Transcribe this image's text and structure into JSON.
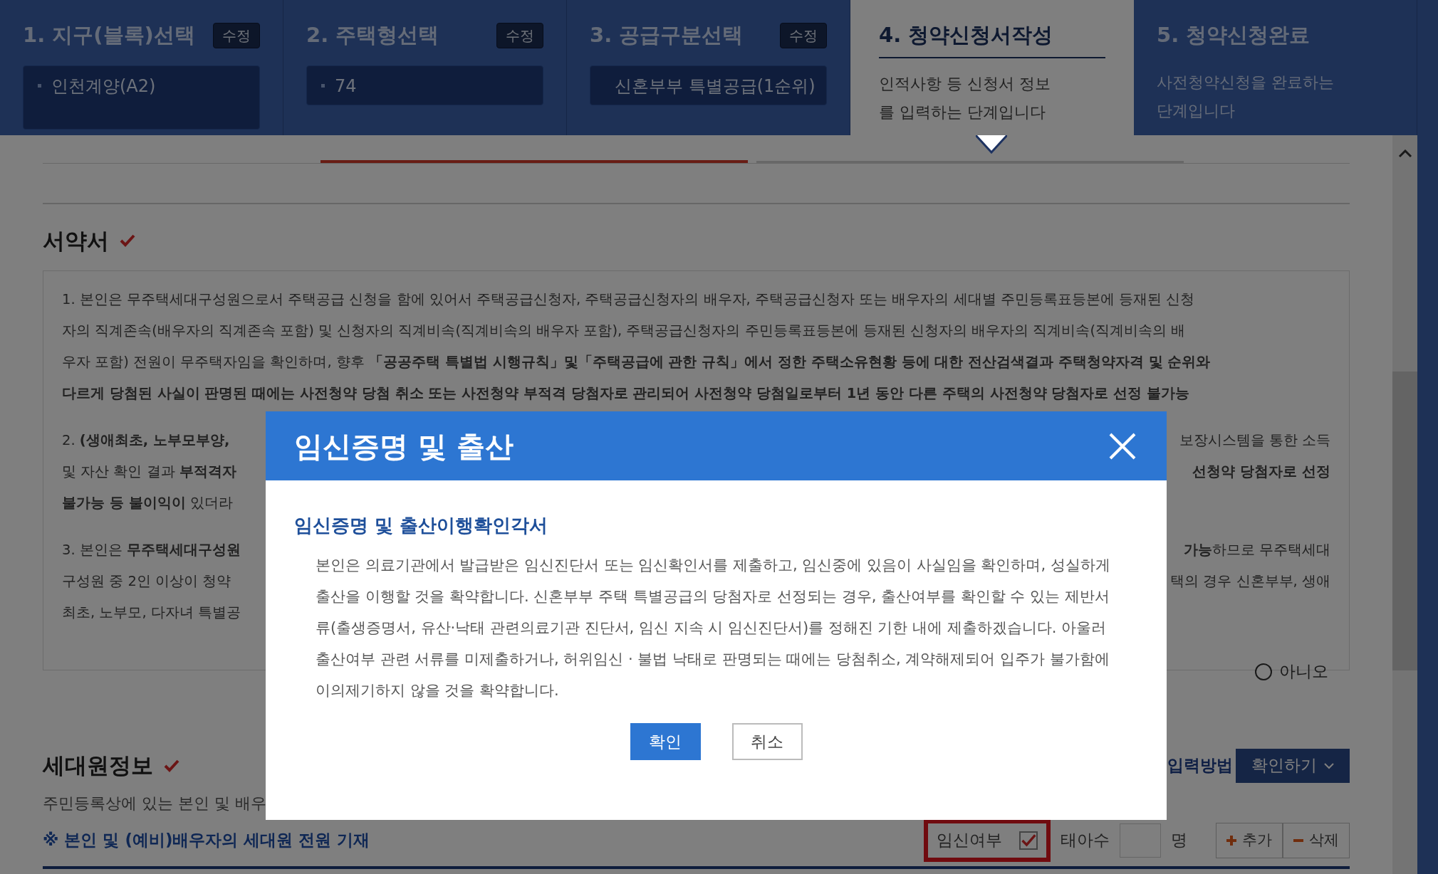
{
  "steps": [
    {
      "title": "1. 지구(블록)선택",
      "edit_button": "수정",
      "value": "인천계양(A2)",
      "selected": false
    },
    {
      "title": "2. 주택형선택",
      "edit_button": "수정",
      "value": "74",
      "selected": false
    },
    {
      "title": "3. 공급구분선택",
      "edit_button": "수정",
      "value": "신혼부부 특별공급(1순위)",
      "selected": false
    },
    {
      "title": "4. 청약신청서작성",
      "description": "인적사항 등 신청서 정보를 입력하는 단계입니다",
      "selected": true
    },
    {
      "title": "5. 청약신청완료",
      "description": "사전청약신청을 완료하는 단계입니다",
      "selected": false
    }
  ],
  "pledge": {
    "title": "서약서",
    "checked": true,
    "paragraphs": [
      {
        "lines": [
          {
            "left": "1. 본인은 무주택세대구성원으로서 주택공급 신청을 함에 있어서 주택공급신청자, 주택공급신청자의 배우자, 주택공급신청자 또는 배우자의 세대별 주민등록표등본에 등재된 신청"
          },
          {
            "left": "자의 직계존속(배우자의 직계존속 포함) 및 신청자의 직계비속(직계비속의 배우자 포함), 주택공급신청자의 주민등록표등본에 등재된 신청자의 배우자의 직계비속(직계비속의 배"
          },
          {
            "left": "우자 포함) 전원이 무주택자임을 확인하며, 향후 **「공공주택 특별법 시행규칙」및「주택공급에 관한 규칙」에서 정한 주택소유현황 등에 대한 전산검색결과 주택청약자격 및 순위와**"
          },
          {
            "left": "**다르게 당첨된 사실이 판명된 때에는 사전청약 당첨 취소 또는 사전청약 부적격 당첨자로 관리되어 사전청약 당첨일로부터 1년 동안 다른 주택의 사전청약 당첨자로 선정 불가능**"
          }
        ]
      },
      {
        "lines": [
          {
            "left": "2. **(생애최초, 노부모부양,**",
            "right": "보장시스템을 통한 소득"
          },
          {
            "left": "및 자산 확인 결과 **부적격자**",
            "right": "**선청약 당첨자로 선정**"
          },
          {
            "left": "**불가능 등 불이익이** 있더라"
          }
        ]
      },
      {
        "lines": [
          {
            "left": "3. 본인은 **무주택세대구성원**",
            "right": "**가능**하므로 무주택세대"
          },
          {
            "left": "구성원 중 2인 이상이 청약",
            "right": "택의 경우 신혼부부, 생애"
          },
          {
            "left": "최초, 노부모, 다자녀 특별공"
          }
        ]
      }
    ]
  },
  "answer_radio": {
    "label": "아니오",
    "selected": false
  },
  "household": {
    "title": "세대원정보",
    "checked": true,
    "input_method_link": "입력방법",
    "confirm_button": "확인하기",
    "description": "주민등록상에 있는 본인 및 배우",
    "notice": "※ 본인 및 (예비)배우자의 세대원 전원 기재",
    "pregnancy": {
      "label": "임신여부",
      "checked": true
    },
    "fetus_count": {
      "label": "태아수",
      "unit": "명"
    },
    "add_button": "추가",
    "delete_button": "삭제"
  },
  "modal": {
    "title": "임신증명 및 출산",
    "subtitle": "임신증명 및 출산이행확인각서",
    "body": "본인은 의료기관에서 발급받은 임신진단서 또는 임신확인서를 제출하고, 임신중에 있음이 사실임을 확인하며, 성실하게 출산을 이행할 것을 확약합니다. 신혼부부 주택 특별공급의 당첨자로 선정되는 경우, 출산여부를 확인할 수 있는 제반서류(출생증명서, 유산·낙태 관련의료기관 진단서, 임신 지속 시 임신진단서)를 정해진 기한 내에 제출하겠습니다. 아울러 출산여부 관련 서류를 미제출하거나, 허위임신 · 불법 낙태로 판명되는 때에는 당첨취소, 계약해제되어 입주가 불가함에 이의제기하지 않을 것을 확약합니다.",
    "buttons": [
      {
        "label": "확인",
        "kind": "primary"
      },
      {
        "label": "취소",
        "kind": "secondary"
      }
    ]
  }
}
